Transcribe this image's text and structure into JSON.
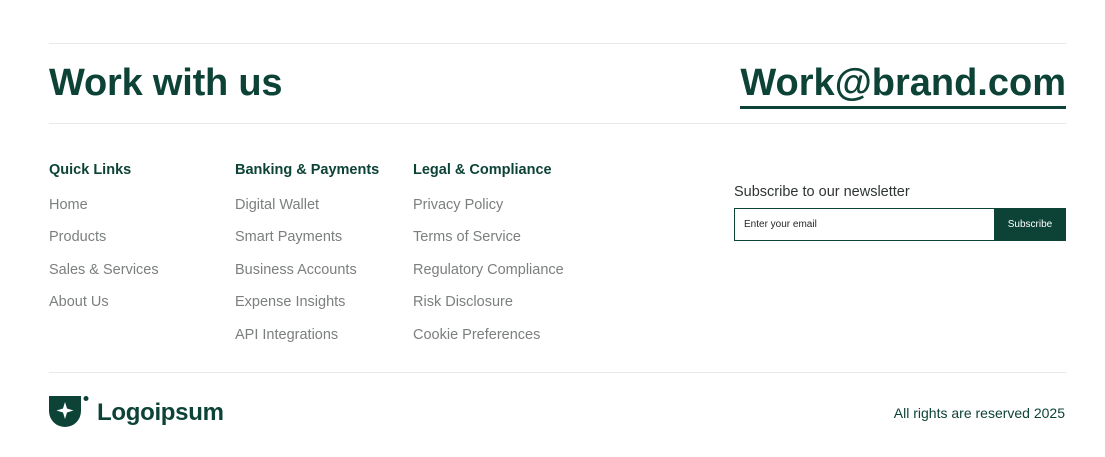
{
  "hero": {
    "title": "Work with us",
    "email": "Work@brand.com"
  },
  "columns": [
    {
      "heading": "Quick Links",
      "items": [
        "Home",
        "Products",
        "Sales & Services",
        "About Us"
      ]
    },
    {
      "heading": "Banking & Payments",
      "items": [
        "Digital Wallet",
        "Smart Payments",
        "Business Accounts",
        "Expense Insights",
        "API Integrations"
      ]
    },
    {
      "heading": "Legal & Compliance",
      "items": [
        "Privacy Policy",
        "Terms of Service",
        "Regulatory Compliance",
        "Risk Disclosure",
        "Cookie Preferences"
      ]
    }
  ],
  "newsletter": {
    "label": "Subscribe to our newsletter",
    "input_placeholder": "Enter your email",
    "input_value": "",
    "button_label": "Subscribe"
  },
  "footer": {
    "brand_name": "Logoipsum",
    "logo_icon": "shield-star-logo-icon",
    "copyright": "All rights are reserved 2025"
  },
  "colors": {
    "brand": "#0c4336",
    "link_text": "#7b7f7d",
    "divider": "#e7e9e8"
  }
}
